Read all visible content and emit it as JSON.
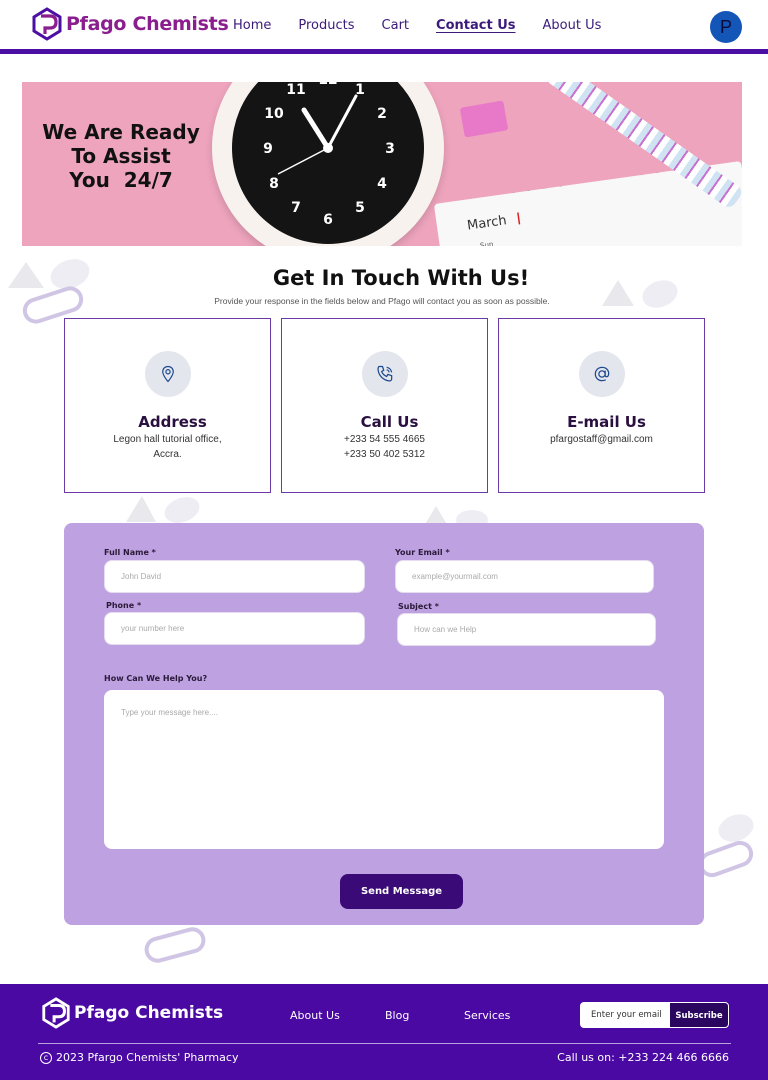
{
  "header": {
    "brand": "Pfago Chemists",
    "nav": [
      "Home",
      "Products",
      "Cart",
      "Contact Us",
      "About Us"
    ],
    "active_nav": "Contact Us",
    "avatar_initial": "P"
  },
  "hero": {
    "line1": "We Are Ready",
    "line2": "To Assist",
    "line3": "You  24/7"
  },
  "contact": {
    "title": "Get In Touch With Us!",
    "subtitle": "Provide your response in the fields below and Pfago will contact you as soon as possible.",
    "cards": [
      {
        "title": "Address",
        "lines": [
          "Legon hall tutorial office,",
          "Accra."
        ],
        "icon": "location-pin-icon"
      },
      {
        "title": "Call Us",
        "lines": [
          "+233 54 555 4665",
          "+233 50 402 5312"
        ],
        "icon": "phone-icon"
      },
      {
        "title": "E-mail Us",
        "lines": [
          "pfargostaff@gmail.com"
        ],
        "icon": "at-sign-icon"
      }
    ]
  },
  "form": {
    "full_name_label": "Full Name *",
    "full_name_placeholder": "John David",
    "email_label": "Your Email *",
    "email_placeholder": "example@yourmail.com",
    "phone_label": "Phone *",
    "phone_placeholder": "your number here",
    "subject_label": "Subject *",
    "subject_placeholder": "How can we Help",
    "message_label": "How Can We Help You?",
    "message_placeholder": "Type your message here....",
    "submit_label": "Send Message"
  },
  "footer": {
    "brand": "Pfago Chemists",
    "links": [
      "About Us",
      "Blog",
      "Services"
    ],
    "subscribe_placeholder": "Enter your email",
    "subscribe_label": "Subscribe",
    "copyright": "2023 Pfargo Chemists' Pharmacy",
    "call": "Call us on: +233 224 466 6666"
  },
  "colors": {
    "brand_purple": "#4b09a3",
    "logo_magenta": "#8b1e8f",
    "form_bg": "#bea1e0",
    "button_dark": "#3a0a77",
    "hero_pink": "#eea4bd",
    "avatar_blue": "#1456b8"
  }
}
